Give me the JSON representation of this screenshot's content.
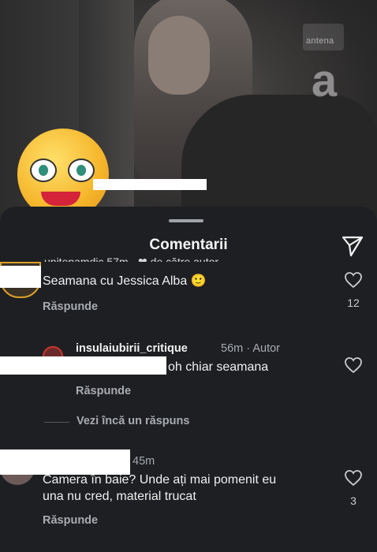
{
  "video": {
    "watermark_text": "antena",
    "watermark_logo": "a"
  },
  "sheet": {
    "title": "Comentarii",
    "clipped_header": "unitenamdic 57m · ❤ de către autor"
  },
  "comments": [
    {
      "text": "Seamana cu Jessica Alba",
      "emoji": "🙂",
      "reply_label": "Răspunde",
      "like_count": "12"
    },
    {
      "username": "insulaiubirii_critique",
      "time": "56m",
      "author_badge": "Autor",
      "text": "oh chiar seamana",
      "reply_label": "Răspunde",
      "more_replies_label": "Vezi încă un răspuns"
    },
    {
      "time": "45m",
      "text_line1": "Camera în baie? Unde ați mai pomenit eu",
      "text_line2": "una nu cred, material  trucat",
      "reply_label": "Răspunde",
      "like_count": "3"
    }
  ],
  "icons": {
    "send": "send-icon",
    "heart": "heart-icon"
  }
}
